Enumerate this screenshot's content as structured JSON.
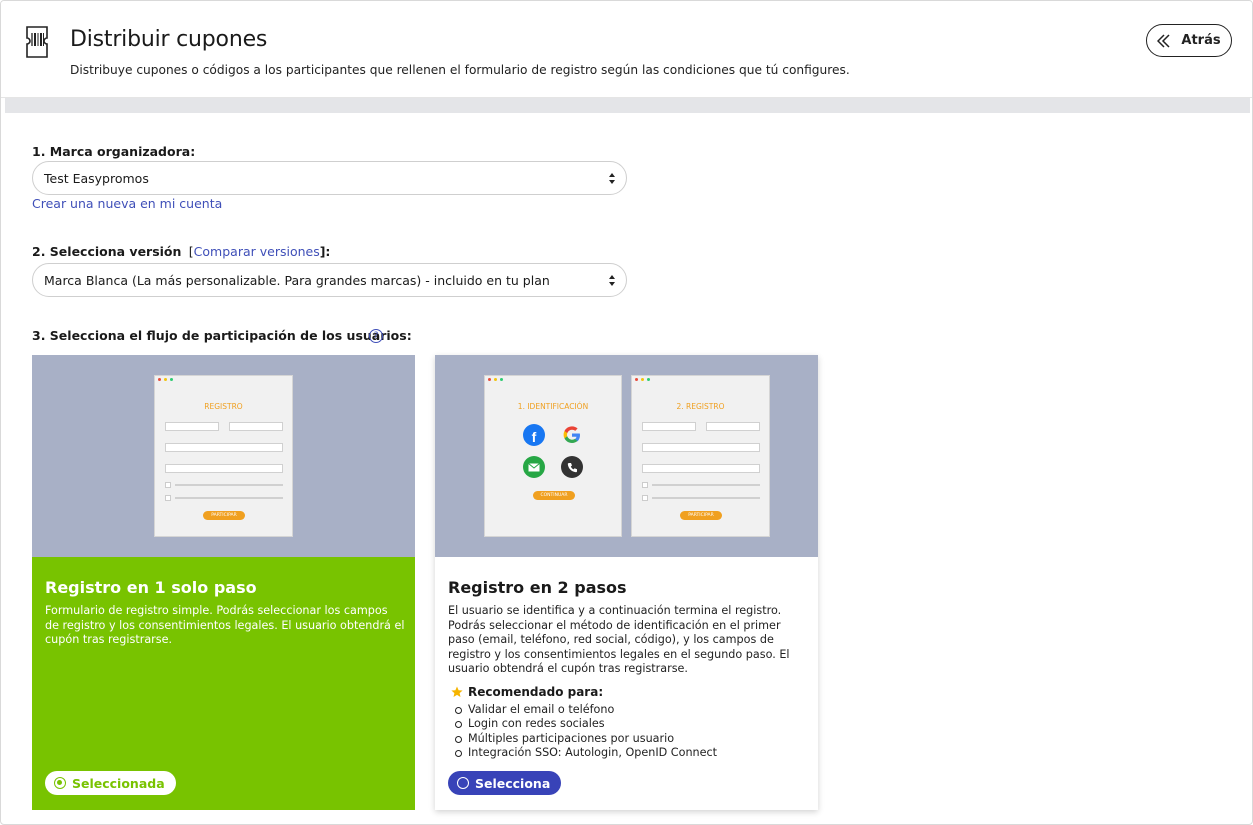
{
  "header": {
    "title": "Distribuir cupones",
    "subtitle": "Distribuye cupones o códigos a los participantes que rellenen el formulario de registro según las condiciones que tú configures.",
    "back_label": "Atrás",
    "icon": "coupon-icon"
  },
  "form": {
    "brand": {
      "label": "1. Marca organizadora:",
      "value": "Test Easypromos",
      "create_link": "Crear una nueva en mi cuenta"
    },
    "version": {
      "label": "2. Selecciona versión",
      "compare_open": "[",
      "compare_link": "Comparar versiones",
      "compare_close": "]:",
      "value": "Marca Blanca (La más personalizable. Para grandes marcas) - incluido en tu plan"
    },
    "flow": {
      "label": "3. Selecciona el flujo de participación de los usuarios:",
      "help": "?"
    }
  },
  "cards": [
    {
      "title": "Registro en 1 solo paso",
      "description": "Formulario de registro simple. Podrás seleccionar los campos de registro y los consentimientos legales. El usuario obtendrá el cupón tras registrarse.",
      "button_label": "Seleccionada",
      "selected": true,
      "preview": {
        "form_title": "REGISTRO",
        "button": "PARTICIPAR"
      }
    },
    {
      "title": "Registro en 2 pasos",
      "description": "El usuario se identifica y a continuación termina el registro. Podrás seleccionar el método de identificación en el primer paso (email, teléfono, red social, código), y los campos de registro y los consentimientos legales en el segundo paso. El usuario obtendrá el cupón tras registrarse.",
      "recommended_title": "Recomendado para:",
      "recommended": [
        "Validar el email o teléfono",
        "Login con redes sociales",
        "Múltiples participaciones por usuario",
        "Integración SSO: Autologin, OpenID Connect"
      ],
      "button_label": "Selecciona",
      "selected": false,
      "preview": {
        "step1_title": "1. IDENTIFICACIÓN",
        "step1_button": "CONTINUAR",
        "step2_title": "2. REGISTRO",
        "step2_button": "PARTICIPAR"
      }
    }
  ],
  "colors": {
    "accent": "#78c300",
    "primary": "#3843b8",
    "link": "#3f4fb8",
    "preview_bg": "#a8b0c6",
    "mock_button": "#f0a020"
  }
}
